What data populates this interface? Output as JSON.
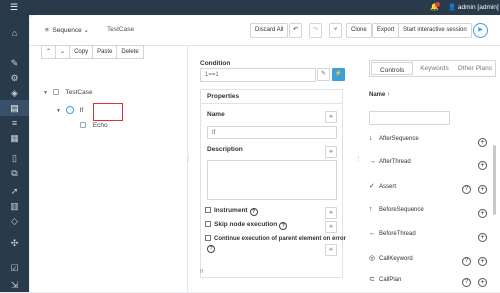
{
  "topbar": {
    "user": "admin [admin]",
    "user_icon": "person-icon",
    "bell_icon": "bell-icon"
  },
  "sidebar": {
    "icons": [
      "home-icon",
      "edit-icon",
      "gear-icon",
      "cube-icon",
      "document-icon",
      "list-icon",
      "clipboard-icon",
      "file-icon",
      "layers-icon",
      "rocket-icon",
      "chart-icon",
      "diamond-icon",
      "puzzle-icon",
      "check-icon",
      "export-icon"
    ],
    "active_index": 4
  },
  "header": {
    "type_select": "Sequence",
    "name": "TestCase",
    "buttons": {
      "discard": "Discard All",
      "clone": "Clone",
      "export": "Export",
      "start": "Start interactive session"
    }
  },
  "tree": {
    "toolbar": {
      "up": "⌃",
      "down": "⌄",
      "copy": "Copy",
      "paste": "Paste",
      "delete": "Delete"
    },
    "items": [
      {
        "label": "TestCase"
      },
      {
        "label": "If"
      },
      {
        "label": "Echo"
      }
    ]
  },
  "condition": {
    "label": "Condition",
    "value": "1==1"
  },
  "properties": {
    "title": "Properties",
    "name_label": "Name",
    "name_value": "If",
    "description_label": "Description",
    "instrument_label": "Instrument",
    "skip_label": "Skip node execution",
    "continue_label": "Continue execution of parent element on error",
    "footer_value": "If"
  },
  "library": {
    "tabs": [
      "Controls",
      "Keywords",
      "Other Plans"
    ],
    "active_tab": 0,
    "sort_label": "Name",
    "items": [
      {
        "label": "AfterSequence",
        "icon": "arrow-down-icon",
        "help": false
      },
      {
        "label": "AfterThread",
        "icon": "arrow-right-icon",
        "help": false
      },
      {
        "label": "Assert",
        "icon": "check-icon",
        "help": true
      },
      {
        "label": "BeforeSequence",
        "icon": "arrow-up-icon",
        "help": false
      },
      {
        "label": "BeforeThread",
        "icon": "arrow-left-icon",
        "help": false
      },
      {
        "label": "CallKeyword",
        "icon": "target-icon",
        "help": true
      },
      {
        "label": "CallPlan",
        "icon": "link-icon",
        "help": true
      }
    ]
  }
}
